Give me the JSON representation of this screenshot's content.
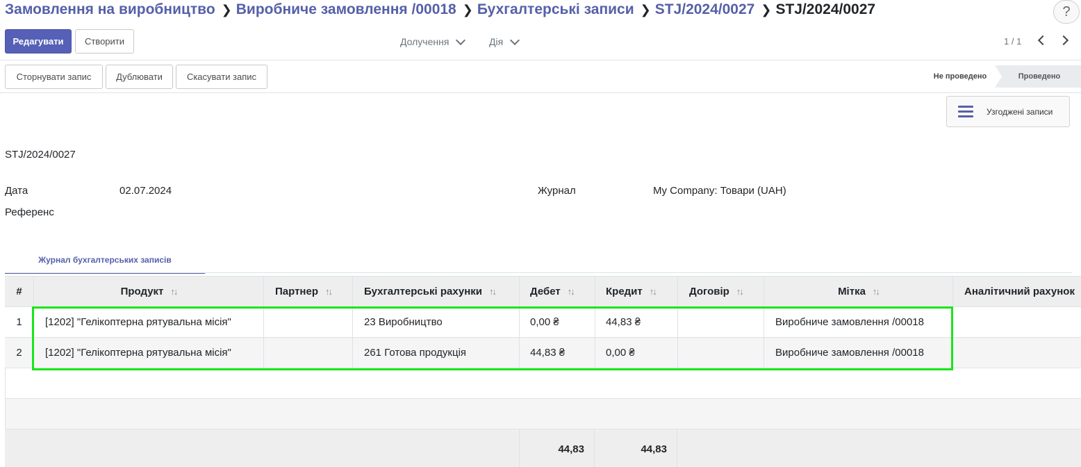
{
  "breadcrumb": {
    "items": [
      "Замовлення на виробництво",
      "Виробниче замовлення /00018",
      "Бухгалтерські записи",
      "STJ/2024/0027"
    ],
    "current": "STJ/2024/0027",
    "separator": "❯"
  },
  "help_label": "?",
  "control_panel": {
    "edit_label": "Редагувати",
    "create_label": "Створити",
    "attach_label": "Долучення",
    "action_label": "Дія",
    "pager": "1 / 1"
  },
  "header_buttons": {
    "reverse": "Сторнувати запис",
    "duplicate": "Дублювати",
    "cancel": "Скасувати запис"
  },
  "status": {
    "draft": "Не проведено",
    "posted": "Проведено",
    "active": "posted"
  },
  "smart_button": {
    "label": "Узгоджені записи",
    "icon": "bars-icon"
  },
  "form": {
    "name": "STJ/2024/0027",
    "date_label": "Дата",
    "date_value": "02.07.2024",
    "journal_label": "Журнал",
    "journal_value": "My Company: Товари (UAH)",
    "ref_label": "Референс",
    "ref_value": ""
  },
  "notebook": {
    "tab_label": "Журнал бухгалтерських записів"
  },
  "table": {
    "columns": [
      "#",
      "Продукт",
      "Партнер",
      "Бухгалтерські рахунки",
      "Дебет",
      "Кредит",
      "Договір",
      "Мітка",
      "Аналітичний рахунок"
    ],
    "rows": [
      [
        "1",
        "[1202] \"Гелікоптерна рятувальна місія\"",
        "",
        "23 Виробництво",
        "0,00 ₴",
        "44,83 ₴",
        "",
        "Виробниче замовлення /00018",
        ""
      ],
      [
        "2",
        "[1202] \"Гелікоптерна рятувальна місія\"",
        "",
        "261 Готова продукція",
        "44,83 ₴",
        "0,00 ₴",
        "",
        "Виробниче замовлення /00018",
        ""
      ]
    ],
    "totals": {
      "debit": "44,83",
      "credit": "44,83"
    }
  },
  "colors": {
    "primary": "#5560b6",
    "link": "#5560a8",
    "highlight": "#19e619"
  }
}
